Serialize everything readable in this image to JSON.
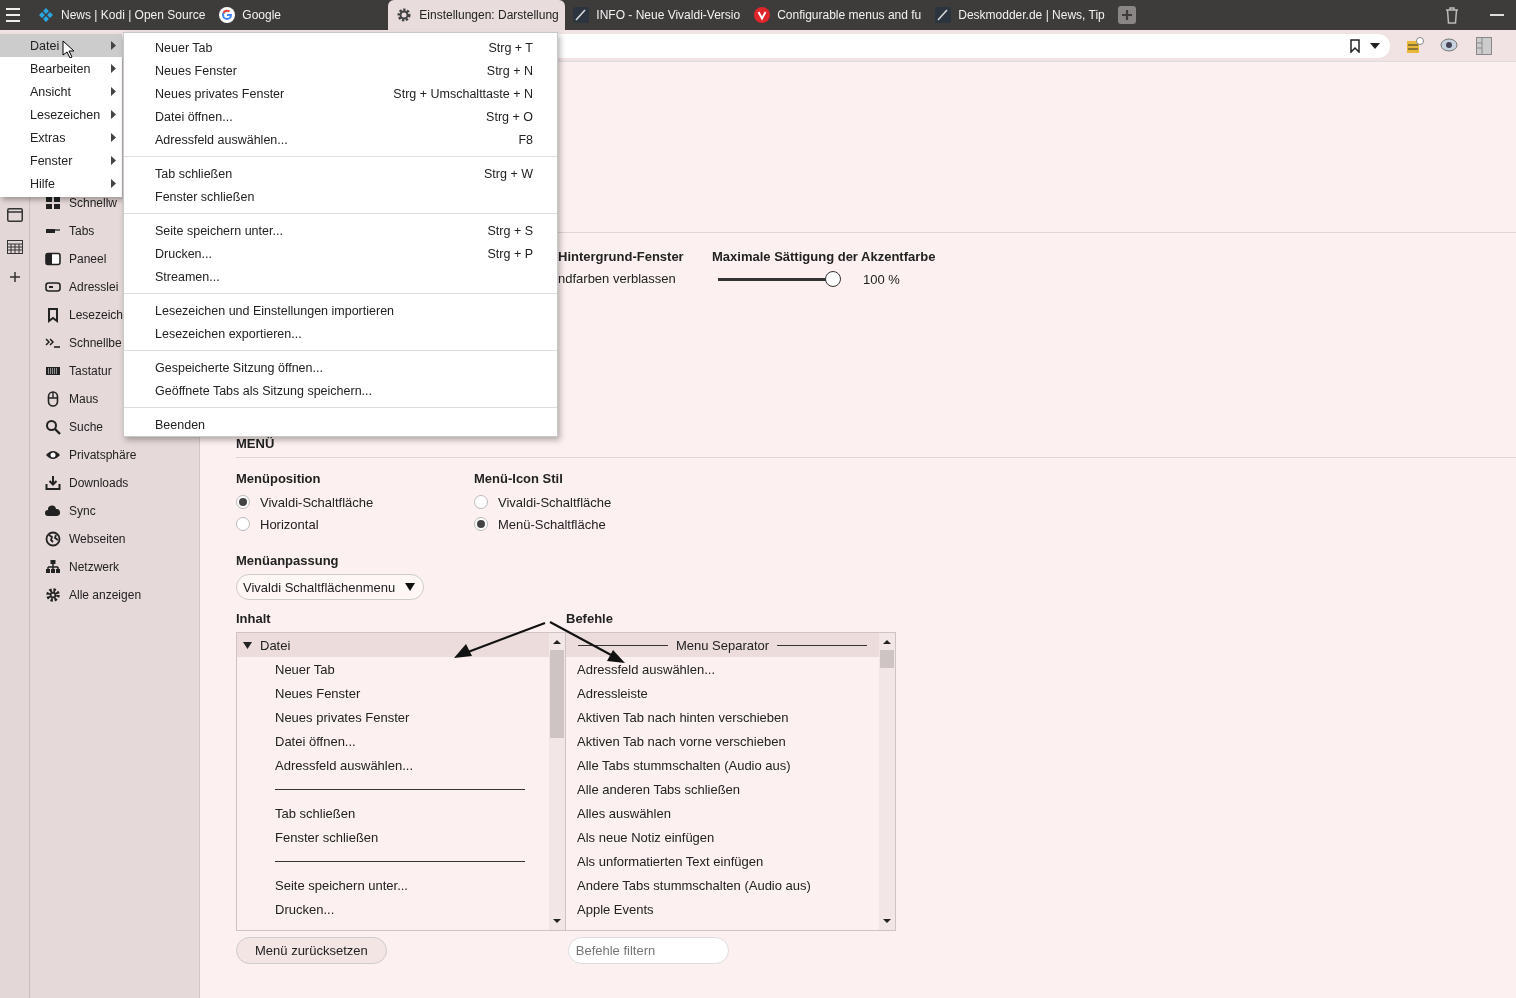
{
  "tabbar": {
    "tabs": [
      {
        "title": "News | Kodi | Open Source",
        "kind": "kodi",
        "selected": false
      },
      {
        "title": "Google",
        "kind": "google",
        "selected": false
      },
      {
        "title": "Einstellungen: Darstellung",
        "kind": "gear",
        "selected": true
      },
      {
        "title": "INFO - Neue Vivaldi-Versio",
        "kind": "pen",
        "selected": false
      },
      {
        "title": "Configurable menus and fu",
        "kind": "vivaldi",
        "selected": false
      },
      {
        "title": "Deskmodder.de | News, Tip",
        "kind": "pen",
        "selected": false
      }
    ]
  },
  "settings_nav": {
    "items": [
      {
        "label": "Schnellw",
        "kind": "grid"
      },
      {
        "label": "Tabs",
        "kind": "tabs"
      },
      {
        "label": "Paneel",
        "kind": "panel"
      },
      {
        "label": "Adresslei",
        "kind": "address"
      },
      {
        "label": "Lesezeich",
        "kind": "bookmark"
      },
      {
        "label": "Schnellbe",
        "kind": "prompt"
      },
      {
        "label": "Tastatur",
        "kind": "keyboard"
      },
      {
        "label": "Maus",
        "kind": "mouse"
      },
      {
        "label": "Suche",
        "kind": "search"
      },
      {
        "label": "Privatsphäre",
        "kind": "eye"
      },
      {
        "label": "Downloads",
        "kind": "download"
      },
      {
        "label": "Sync",
        "kind": "cloud"
      },
      {
        "label": "Webseiten",
        "kind": "globe"
      },
      {
        "label": "Netzwerk",
        "kind": "network"
      },
      {
        "label": "Alle anzeigen",
        "kind": "gear"
      }
    ]
  },
  "appearance": {
    "background_window": {
      "title": "Hintergrund-Fenster",
      "option": "ndfarben verblassen"
    },
    "accent_saturation": {
      "label": "Maximale Sättigung der Akzentfarbe",
      "level": 1,
      "reading": "100 %"
    }
  },
  "menu_section": {
    "heading": "MENÜ",
    "position": {
      "label": "Menüposition",
      "options": [
        {
          "label": "Vivaldi-Schaltfläche",
          "selected": true
        },
        {
          "label": "Horizontal",
          "selected": false
        }
      ]
    },
    "icon_style": {
      "label": "Menü-Icon Stil",
      "options": [
        {
          "label": "Vivaldi-Schaltfläche",
          "selected": false
        },
        {
          "label": "Menü-Schaltfläche",
          "selected": true
        }
      ]
    },
    "customization": {
      "label": "Menüanpassung",
      "dropdown": "Vivaldi Schaltflächenmenu"
    },
    "content": {
      "label": "Inhalt",
      "tree": [
        {
          "label": "Datei",
          "expanded": true,
          "selected": true,
          "children": [
            {
              "kind": "item",
              "label": "Neuer Tab",
              "selected": false
            },
            {
              "kind": "item",
              "label": "Neues Fenster",
              "selected": false
            },
            {
              "kind": "item",
              "label": "Neues privates Fenster",
              "selected": false
            },
            {
              "kind": "item",
              "label": "Datei öffnen...",
              "selected": false
            },
            {
              "kind": "item",
              "label": "Adressfeld auswählen...",
              "selected": false
            },
            {
              "kind": "separator",
              "selected": false
            },
            {
              "kind": "item",
              "label": "Tab schließen",
              "selected": false
            },
            {
              "kind": "item",
              "label": "Fenster schließen",
              "selected": false
            },
            {
              "kind": "separator",
              "selected": false
            },
            {
              "kind": "item",
              "label": "Seite speichern unter...",
              "selected": false
            },
            {
              "kind": "item",
              "label": "Drucken...",
              "selected": false
            }
          ]
        }
      ]
    },
    "commands": {
      "label": "Befehle",
      "items": [
        {
          "kind": "separator",
          "label": "Menu Separator",
          "selected": true
        },
        {
          "kind": "item",
          "label": "Adressfeld auswählen...",
          "selected": false
        },
        {
          "kind": "item",
          "label": "Adressleiste",
          "selected": false
        },
        {
          "kind": "item",
          "label": "Aktiven Tab nach hinten verschieben",
          "selected": false
        },
        {
          "kind": "item",
          "label": "Aktiven Tab nach vorne verschieben",
          "selected": false
        },
        {
          "kind": "item",
          "label": "Alle Tabs stummschalten (Audio aus)",
          "selected": false
        },
        {
          "kind": "item",
          "label": "Alle anderen Tabs schließen",
          "selected": false
        },
        {
          "kind": "item",
          "label": "Alles auswählen",
          "selected": false
        },
        {
          "kind": "item",
          "label": "Als neue Notiz einfügen",
          "selected": false
        },
        {
          "kind": "item",
          "label": "Als unformatierten Text einfügen",
          "selected": false
        },
        {
          "kind": "item",
          "label": "Andere Tabs stummschalten (Audio aus)",
          "selected": false
        },
        {
          "kind": "item",
          "label": "Apple Events",
          "selected": false
        }
      ]
    },
    "reset_button": "Menü zurücksetzen",
    "filter": {
      "placeholder": "Befehle filtern"
    }
  },
  "menubar_popup": {
    "items": [
      {
        "label": "Datei",
        "selected": true
      },
      {
        "label": "Bearbeiten",
        "selected": false
      },
      {
        "label": "Ansicht",
        "selected": false
      },
      {
        "label": "Lesezeichen",
        "selected": false
      },
      {
        "label": "Extras",
        "selected": false
      },
      {
        "label": "Fenster",
        "selected": false
      },
      {
        "label": "Hilfe",
        "selected": false
      }
    ],
    "submenu": {
      "items": [
        {
          "kind": "item",
          "label": "Neuer Tab",
          "shortcut": "Strg + T"
        },
        {
          "kind": "item",
          "label": "Neues Fenster",
          "shortcut": "Strg + N"
        },
        {
          "kind": "item",
          "label": "Neues privates Fenster",
          "shortcut": "Strg + Umschalttaste + N"
        },
        {
          "kind": "item",
          "label": "Datei öffnen...",
          "shortcut": "Strg + O"
        },
        {
          "kind": "item",
          "label": "Adressfeld auswählen...",
          "shortcut": "F8"
        },
        {
          "kind": "separator"
        },
        {
          "kind": "item",
          "label": "Tab schließen",
          "shortcut": "Strg + W"
        },
        {
          "kind": "item",
          "label": "Fenster schließen"
        },
        {
          "kind": "separator"
        },
        {
          "kind": "item",
          "label": "Seite speichern unter...",
          "shortcut": "Strg + S"
        },
        {
          "kind": "item",
          "label": "Drucken...",
          "shortcut": "Strg + P"
        },
        {
          "kind": "item",
          "label": "Streamen..."
        },
        {
          "kind": "separator"
        },
        {
          "kind": "item",
          "label": "Lesezeichen und Einstellungen importieren"
        },
        {
          "kind": "item",
          "label": "Lesezeichen exportieren..."
        },
        {
          "kind": "separator"
        },
        {
          "kind": "item",
          "label": "Gespeicherte Sitzung öffnen..."
        },
        {
          "kind": "item",
          "label": "Geöffnete Tabs als Sitzung speichern..."
        },
        {
          "kind": "separator"
        },
        {
          "kind": "item",
          "label": "Beenden"
        }
      ]
    }
  }
}
